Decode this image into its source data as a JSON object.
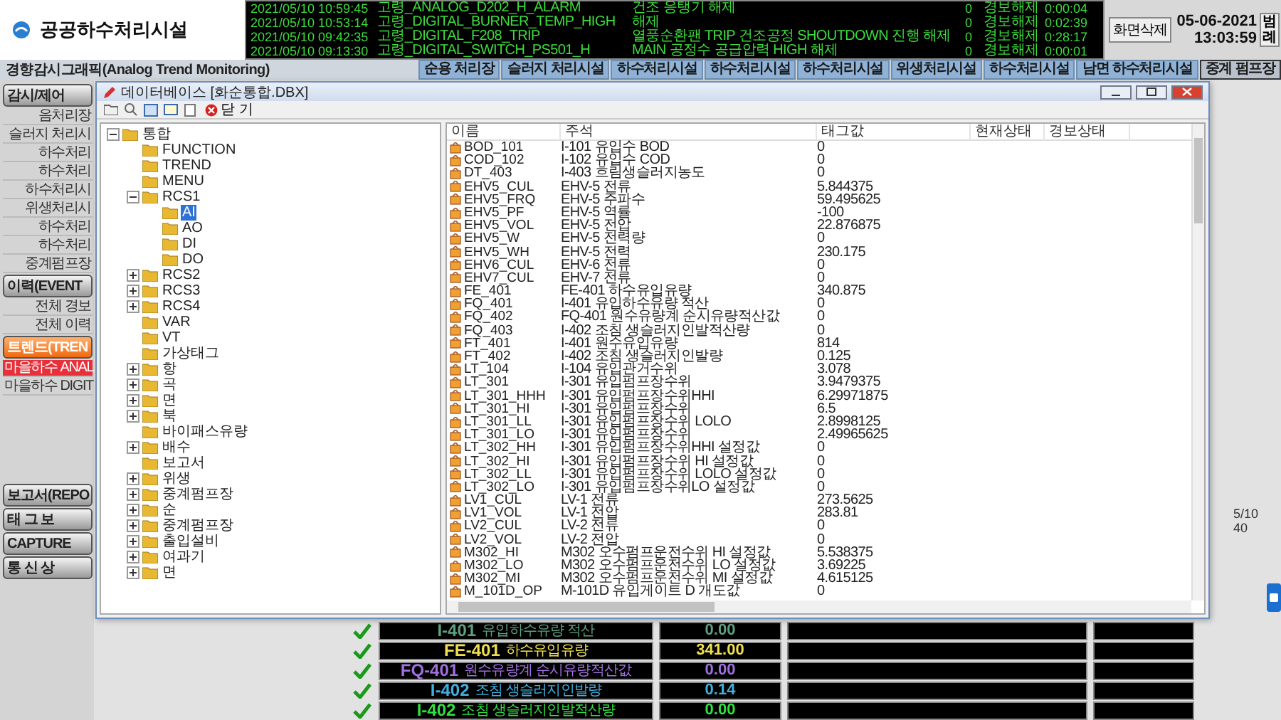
{
  "header": {
    "title": "공공하수처리시설",
    "alarms": [
      {
        "time": "2021/05/10 10:59:45",
        "tag": "고령_ANALOG_D202_H_ALARM",
        "message": "건조 응탱기 해제",
        "count": "0",
        "status": "경보해제",
        "duration": "0:00:04"
      },
      {
        "time": "2021/05/10 10:53:14",
        "tag": "고령_DIGITAL_BURNER_TEMP_HIGH",
        "message": "해제",
        "count": "0",
        "status": "경보해제",
        "duration": "0:02:39"
      },
      {
        "time": "2021/05/10 09:42:35",
        "tag": "고령_DIGITAL_F208_TRIP",
        "message": "열풍순환팬 TRIP 건조공정 SHOUTDOWN 진행 해제",
        "count": "0",
        "status": "경보해제",
        "duration": "0:28:17"
      },
      {
        "time": "2021/05/10 09:13:30",
        "tag": "고령_DIGITAL_SWITCH_PS501_H",
        "message": "MAIN 공정수 공급압력 HIGH 해제",
        "count": "0",
        "status": "경보해제",
        "duration": "0:00:01"
      }
    ],
    "clear_button": "화면삭제",
    "date": "05-06-2021",
    "clock": "13:03:59",
    "legend_button": "범례"
  },
  "tab_bar": {
    "title": "경향감시그래픽(Analog Trend Monitoring)",
    "tabs": [
      {
        "label": "순용 처리장",
        "selected": false
      },
      {
        "label": "슬러지 처리시설",
        "selected": false
      },
      {
        "label": "하수처리시설",
        "selected": false
      },
      {
        "label": "하수처리시설",
        "selected": false
      },
      {
        "label": "하수처리시설",
        "selected": false
      },
      {
        "label": "위생처리시설",
        "selected": false
      },
      {
        "label": "하수처리시설",
        "selected": false
      },
      {
        "label": "남면 하수처리시설",
        "selected": false
      },
      {
        "label": "중계 펌프장",
        "selected": true
      }
    ]
  },
  "sidebar": {
    "items": [
      {
        "kind": "button",
        "label": "감시/제어",
        "selected": false
      },
      {
        "kind": "item",
        "label": "음처리장",
        "selected": false
      },
      {
        "kind": "item",
        "label": "슬러지 처리시",
        "selected": false
      },
      {
        "kind": "item",
        "label": "하수처리",
        "selected": false
      },
      {
        "kind": "item",
        "label": "하수처리",
        "selected": false
      },
      {
        "kind": "item",
        "label": "하수처리시",
        "selected": false
      },
      {
        "kind": "item",
        "label": "위생처리시",
        "selected": false
      },
      {
        "kind": "item",
        "label": "하수처리",
        "selected": false
      },
      {
        "kind": "item",
        "label": "하수처리",
        "selected": false
      },
      {
        "kind": "item",
        "label": "중계펌프장",
        "selected": false
      },
      {
        "kind": "button",
        "label": "이력(EVENT",
        "selected": false
      },
      {
        "kind": "item",
        "label": "전체 경보",
        "selected": false
      },
      {
        "kind": "item",
        "label": "전체 이력",
        "selected": false
      },
      {
        "kind": "button",
        "label": "트렌드(TREN",
        "selected": true
      },
      {
        "kind": "item",
        "label": "마을하수 ANAL",
        "selected": true
      },
      {
        "kind": "item",
        "label": "마을하수 DIGIT",
        "selected": false
      },
      {
        "kind": "spacer"
      },
      {
        "kind": "button",
        "label": "보고서(REPO",
        "selected": false
      },
      {
        "kind": "button",
        "label": "태 그 보",
        "selected": false
      },
      {
        "kind": "button",
        "label": "CAPTURE",
        "selected": false
      },
      {
        "kind": "button",
        "label": "통 신 상",
        "selected": false
      }
    ]
  },
  "dialog": {
    "title": "데이터베이스 [화순통합.DBX]",
    "close_label": "닫 기",
    "tree": [
      {
        "label": "통합",
        "expanded": true,
        "selected": false,
        "children": [
          {
            "label": "FUNCTION",
            "selected": false
          },
          {
            "label": "TREND",
            "selected": false
          },
          {
            "label": "MENU",
            "selected": false
          },
          {
            "label": "RCS1",
            "expanded": true,
            "selected": false,
            "children": [
              {
                "label": "AI",
                "selected": true
              },
              {
                "label": "AO",
                "selected": false
              },
              {
                "label": "DI",
                "selected": false
              },
              {
                "label": "DO",
                "selected": false
              }
            ]
          },
          {
            "label": "RCS2",
            "expanded": false,
            "selected": false
          },
          {
            "label": "RCS3",
            "expanded": false,
            "selected": false
          },
          {
            "label": "RCS4",
            "expanded": false,
            "selected": false
          },
          {
            "label": "VAR",
            "selected": false
          },
          {
            "label": "VT",
            "selected": false
          },
          {
            "label": "가상태그",
            "selected": false
          },
          {
            "label": "항",
            "expanded": false,
            "selected": false
          },
          {
            "label": "곡",
            "expanded": false,
            "selected": false
          },
          {
            "label": "면",
            "expanded": false,
            "selected": false
          },
          {
            "label": "북",
            "expanded": false,
            "selected": false
          },
          {
            "label": "바이패스유량",
            "selected": false
          },
          {
            "label": "배수",
            "expanded": false,
            "selected": false
          },
          {
            "label": "보고서",
            "selected": false
          },
          {
            "label": "위생",
            "expanded": false,
            "selected": false
          },
          {
            "label": "중계펌프장",
            "expanded": false,
            "selected": false
          },
          {
            "label": "순",
            "expanded": false,
            "selected": false
          },
          {
            "label": "중계펌프장",
            "expanded": false,
            "selected": false
          },
          {
            "label": "출입설비",
            "expanded": false,
            "selected": false
          },
          {
            "label": "여과기",
            "expanded": false,
            "selected": false
          },
          {
            "label": "면",
            "expanded": false,
            "selected": false
          }
        ]
      }
    ],
    "columns": [
      "이름",
      "주석",
      "태그값",
      "현재상태",
      "경보상태"
    ],
    "rows": [
      {
        "name": "BOD_101",
        "comment": "I-101  유입수 BOD",
        "value": "0"
      },
      {
        "name": "COD_102",
        "comment": "I-102  유입수 COD",
        "value": "0"
      },
      {
        "name": "DT_403",
        "comment": "I-403  흐림생슬러지농도",
        "value": "0"
      },
      {
        "name": "EHV5_CUL",
        "comment": "EHV-5  전류",
        "value": "5.844375"
      },
      {
        "name": "EHV5_FRQ",
        "comment": "EHV-5  주파수",
        "value": "59.495625"
      },
      {
        "name": "EHV5_PF",
        "comment": "EHV-5  역률",
        "value": "-100"
      },
      {
        "name": "EHV5_VOL",
        "comment": "EHV-5  전압",
        "value": "22.876875"
      },
      {
        "name": "EHV5_W",
        "comment": "EHV-5  전력량",
        "value": "0"
      },
      {
        "name": "EHV5_WH",
        "comment": "EHV-5  전력",
        "value": "230.175"
      },
      {
        "name": "EHV6_CUL",
        "comment": "EHV-6  전류",
        "value": "0"
      },
      {
        "name": "EHV7_CUL",
        "comment": "EHV-7  전류",
        "value": "0"
      },
      {
        "name": "FE_401",
        "comment": "FE-401 하수유입유량",
        "value": "340.875"
      },
      {
        "name": "FQ_401",
        "comment": "I-401  유입하수유량 적산",
        "value": "0"
      },
      {
        "name": "FQ_402",
        "comment": "FQ-401 원수유량계 순시유량적산값",
        "value": "0"
      },
      {
        "name": "FQ_403",
        "comment": "I-402  조침 생슬러지인발적산량",
        "value": "0"
      },
      {
        "name": "FT_401",
        "comment": "I-401  원수유입유량",
        "value": "814"
      },
      {
        "name": "FT_402",
        "comment": "I-402  조침 생슬러지인발량",
        "value": "0.125"
      },
      {
        "name": "LT_104",
        "comment": "I-104  유입관거수위",
        "value": "3.078"
      },
      {
        "name": "LT_301",
        "comment": "I-301  유입펌프장수위",
        "value": "3.9479375"
      },
      {
        "name": "LT_301_HHH",
        "comment": "I-301  유입펌프장수위HHI",
        "value": "6.29971875"
      },
      {
        "name": "LT_301_HI",
        "comment": "I-301  유입펌프장수위",
        "value": "6.5"
      },
      {
        "name": "LT_301_LL",
        "comment": "I-301  유입펌프장수위 LOLO",
        "value": "2.8998125"
      },
      {
        "name": "LT_301_LO",
        "comment": "I-301  유입펌프장수위",
        "value": "2.49965625"
      },
      {
        "name": "LT_302_HH",
        "comment": "I-301  유입펌프장수위HHI 설정값",
        "value": "0"
      },
      {
        "name": "LT_302_HI",
        "comment": "I-301  유입펌프장수위 HI 설정값",
        "value": "0"
      },
      {
        "name": "LT_302_LL",
        "comment": "I-301  유입펌프장수위 LOLO 설정값",
        "value": "0"
      },
      {
        "name": "LT_302_LO",
        "comment": "I-301  유입펌프장수위LO 설정값",
        "value": "0"
      },
      {
        "name": "LV1_CUL",
        "comment": "LV-1  전류",
        "value": "273.5625"
      },
      {
        "name": "LV1_VOL",
        "comment": "LV-1  전압",
        "value": "283.81"
      },
      {
        "name": "LV2_CUL",
        "comment": "LV-2  전류",
        "value": "0"
      },
      {
        "name": "LV2_VOL",
        "comment": "LV-2  전압",
        "value": "0"
      },
      {
        "name": "M302_HI",
        "comment": "M302 오수펌프운전수위 HI 설정값",
        "value": "5.538375"
      },
      {
        "name": "M302_LO",
        "comment": "M302 오수펌프운전수위 LO 설정값",
        "value": "3.69225"
      },
      {
        "name": "M302_MI",
        "comment": "M302 오수펌프운전수위 MI 설정값",
        "value": "4.615125"
      },
      {
        "name": "M_101D_OP",
        "comment": "M-101D 유입게이트 D 개도값",
        "value": "0"
      }
    ]
  },
  "side_note": [
    "5/10",
    "40"
  ],
  "monitor_rows": [
    {
      "tag": "I-401",
      "description": "유입하수유량 적산",
      "value": "0.00",
      "kind": "teal"
    },
    {
      "tag": "FE-401",
      "description": "하수유입유량",
      "value": "341.00",
      "kind": "yellow"
    },
    {
      "tag": "FQ-401",
      "description": "원수유량계 순시유량적산값",
      "value": "0.00",
      "kind": "purple"
    },
    {
      "tag": "I-402",
      "description": "조침 생슬러지인발량",
      "value": "0.14",
      "kind": "cyan"
    },
    {
      "tag": "I-402",
      "description": "조침 생슬러지인발적산량",
      "value": "0.00",
      "kind": "green"
    }
  ]
}
